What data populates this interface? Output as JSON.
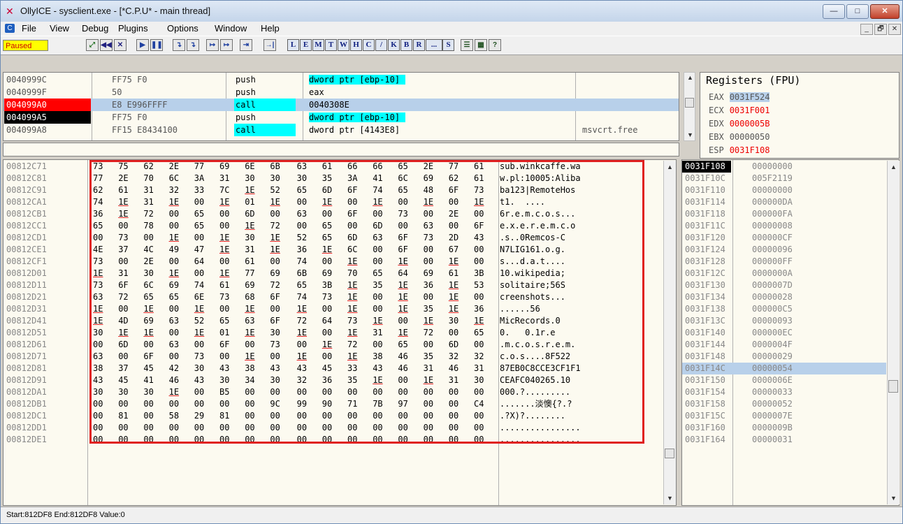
{
  "window": {
    "title": "OllyICE - sysclient.exe - [*C.P.U* - main thread]",
    "controls": {
      "minimize": "—",
      "maximize": "□",
      "close": "✕"
    }
  },
  "menubar": {
    "items": [
      "File",
      "View",
      "Debug",
      "Plugins",
      "Options",
      "Window",
      "Help"
    ],
    "mdi": [
      "_",
      "🗗",
      "✕"
    ]
  },
  "toolbar": {
    "status": "Paused",
    "buttons": [
      "⤢",
      "◀◀",
      "✕",
      "▶",
      "❚❚",
      "↴",
      "↴",
      "↦",
      "↦",
      "⇥",
      "→|"
    ],
    "letters": [
      "L",
      "E",
      "M",
      "T",
      "W",
      "H",
      "C",
      "/",
      "K",
      "B",
      "R",
      "...",
      "S"
    ],
    "extra": [
      "☰",
      "▦",
      "?"
    ]
  },
  "cpu_rows": [
    {
      "addr": "0040999C",
      "hex": "FF75 F0",
      "mnemonic": "push",
      "operand": "dword ptr [ebp-10]",
      "comment": "",
      "addr_style": "normal",
      "mn_hl": false,
      "op_hl": true,
      "selected": false
    },
    {
      "addr": "0040999F",
      "hex": "50",
      "mnemonic": "push",
      "operand": "eax",
      "comment": "",
      "addr_style": "normal",
      "mn_hl": false,
      "op_hl": false,
      "selected": false
    },
    {
      "addr": "004099A0",
      "hex": "E8 E996FFFF",
      "mnemonic": "call",
      "operand": "0040308E",
      "comment": "",
      "addr_style": "bp",
      "mn_hl": true,
      "op_hl": false,
      "selected": true
    },
    {
      "addr": "004099A5",
      "hex": "FF75 F0",
      "mnemonic": "push",
      "operand": "dword ptr [ebp-10]",
      "comment": "",
      "addr_style": "eip",
      "mn_hl": false,
      "op_hl": true,
      "selected": false
    },
    {
      "addr": "004099A8",
      "hex": "FF15 E8434100",
      "mnemonic": "call",
      "operand": "dword ptr [4143E8]",
      "comment": "msvcrt.free",
      "addr_style": "normal",
      "mn_hl": true,
      "op_hl": false,
      "selected": false
    }
  ],
  "registers": {
    "title": "Registers (FPU)",
    "items": [
      {
        "name": "EAX",
        "value": "0031F524",
        "red": false,
        "selected": true
      },
      {
        "name": "ECX",
        "value": "0031F001",
        "red": true,
        "selected": false
      },
      {
        "name": "EDX",
        "value": "0000005B",
        "red": true,
        "selected": false
      },
      {
        "name": "EBX",
        "value": "00000050",
        "red": false,
        "selected": false
      },
      {
        "name": "ESP",
        "value": "0031F108",
        "red": true,
        "selected": false
      }
    ]
  },
  "dump_rows": [
    {
      "addr": "00812C71",
      "bytes": [
        "73",
        "75",
        "62",
        "2E",
        "77",
        "69",
        "6E",
        "6B",
        "63",
        "61",
        "66",
        "66",
        "65",
        "2E",
        "77",
        "61"
      ],
      "ascii": "sub.winkcaffe.wa"
    },
    {
      "addr": "00812C81",
      "bytes": [
        "77",
        "2E",
        "70",
        "6C",
        "3A",
        "31",
        "30",
        "30",
        "30",
        "35",
        "3A",
        "41",
        "6C",
        "69",
        "62",
        "61"
      ],
      "ascii": "w.pl:10005:Aliba"
    },
    {
      "addr": "00812C91",
      "bytes": [
        "62",
        "61",
        "31",
        "32",
        "33",
        "7C",
        "1E",
        "52",
        "65",
        "6D",
        "6F",
        "74",
        "65",
        "48",
        "6F",
        "73"
      ],
      "ascii": "ba123|RemoteHos"
    },
    {
      "addr": "00812CA1",
      "bytes": [
        "74",
        "1E",
        "31",
        "1E",
        "00",
        "1E",
        "01",
        "1E",
        "00",
        "1E",
        "00",
        "1E",
        "00",
        "1E",
        "00",
        "1E"
      ],
      "ascii": "t1.  ...."
    },
    {
      "addr": "00812CB1",
      "bytes": [
        "36",
        "1E",
        "72",
        "00",
        "65",
        "00",
        "6D",
        "00",
        "63",
        "00",
        "6F",
        "00",
        "73",
        "00",
        "2E",
        "00"
      ],
      "ascii": "6r.e.m.c.o.s..."
    },
    {
      "addr": "00812CC1",
      "bytes": [
        "65",
        "00",
        "78",
        "00",
        "65",
        "00",
        "1E",
        "72",
        "00",
        "65",
        "00",
        "6D",
        "00",
        "63",
        "00",
        "6F"
      ],
      "ascii": "e.x.e.r.e.m.c.o"
    },
    {
      "addr": "00812CD1",
      "bytes": [
        "00",
        "73",
        "00",
        "1E",
        "00",
        "1E",
        "30",
        "1E",
        "52",
        "65",
        "6D",
        "63",
        "6F",
        "73",
        "2D",
        "43"
      ],
      "ascii": ".s..0Remcos-C"
    },
    {
      "addr": "00812CE1",
      "bytes": [
        "4E",
        "37",
        "4C",
        "49",
        "47",
        "1E",
        "31",
        "1E",
        "36",
        "1E",
        "6C",
        "00",
        "6F",
        "00",
        "67",
        "00"
      ],
      "ascii": "N7LIG161.o.g."
    },
    {
      "addr": "00812CF1",
      "bytes": [
        "73",
        "00",
        "2E",
        "00",
        "64",
        "00",
        "61",
        "00",
        "74",
        "00",
        "1E",
        "00",
        "1E",
        "00",
        "1E",
        "00"
      ],
      "ascii": "s...d.a.t...."
    },
    {
      "addr": "00812D01",
      "bytes": [
        "1E",
        "31",
        "30",
        "1E",
        "00",
        "1E",
        "77",
        "69",
        "6B",
        "69",
        "70",
        "65",
        "64",
        "69",
        "61",
        "3B"
      ],
      "ascii": "10.wikipedia;"
    },
    {
      "addr": "00812D11",
      "bytes": [
        "73",
        "6F",
        "6C",
        "69",
        "74",
        "61",
        "69",
        "72",
        "65",
        "3B",
        "1E",
        "35",
        "1E",
        "36",
        "1E",
        "53"
      ],
      "ascii": "solitaire;56S"
    },
    {
      "addr": "00812D21",
      "bytes": [
        "63",
        "72",
        "65",
        "65",
        "6E",
        "73",
        "68",
        "6F",
        "74",
        "73",
        "1E",
        "00",
        "1E",
        "00",
        "1E",
        "00"
      ],
      "ascii": "creenshots..."
    },
    {
      "addr": "00812D31",
      "bytes": [
        "1E",
        "00",
        "1E",
        "00",
        "1E",
        "00",
        "1E",
        "00",
        "1E",
        "00",
        "1E",
        "00",
        "1E",
        "35",
        "1E",
        "36"
      ],
      "ascii": "......56"
    },
    {
      "addr": "00812D41",
      "bytes": [
        "1E",
        "4D",
        "69",
        "63",
        "52",
        "65",
        "63",
        "6F",
        "72",
        "64",
        "73",
        "1E",
        "00",
        "1E",
        "30",
        "1E"
      ],
      "ascii": "MicRecords.0"
    },
    {
      "addr": "00812D51",
      "bytes": [
        "30",
        "1E",
        "1E",
        "00",
        "1E",
        "01",
        "1E",
        "30",
        "1E",
        "00",
        "1E",
        "31",
        "1E",
        "72",
        "00",
        "65"
      ],
      "ascii": "0.   0.1r.e"
    },
    {
      "addr": "00812D61",
      "bytes": [
        "00",
        "6D",
        "00",
        "63",
        "00",
        "6F",
        "00",
        "73",
        "00",
        "1E",
        "72",
        "00",
        "65",
        "00",
        "6D",
        "00"
      ],
      "ascii": ".m.c.o.s.r.e.m."
    },
    {
      "addr": "00812D71",
      "bytes": [
        "63",
        "00",
        "6F",
        "00",
        "73",
        "00",
        "1E",
        "00",
        "1E",
        "00",
        "1E",
        "38",
        "46",
        "35",
        "32",
        "32"
      ],
      "ascii": "c.o.s....8F522"
    },
    {
      "addr": "00812D81",
      "bytes": [
        "38",
        "37",
        "45",
        "42",
        "30",
        "43",
        "38",
        "43",
        "43",
        "45",
        "33",
        "43",
        "46",
        "31",
        "46",
        "31"
      ],
      "ascii": "87EB0C8CCE3CF1F1"
    },
    {
      "addr": "00812D91",
      "bytes": [
        "43",
        "45",
        "41",
        "46",
        "43",
        "30",
        "34",
        "30",
        "32",
        "36",
        "35",
        "1E",
        "00",
        "1E",
        "31",
        "30"
      ],
      "ascii": "CEAFC040265.10"
    },
    {
      "addr": "00812DA1",
      "bytes": [
        "30",
        "30",
        "30",
        "1E",
        "00",
        "B5",
        "00",
        "00",
        "00",
        "00",
        "00",
        "00",
        "00",
        "00",
        "00",
        "00"
      ],
      "ascii": "000.?........."
    },
    {
      "addr": "00812DB1",
      "bytes": [
        "00",
        "00",
        "00",
        "00",
        "00",
        "00",
        "00",
        "9C",
        "99",
        "90",
        "71",
        "7B",
        "97",
        "00",
        "00",
        "C4"
      ],
      "ascii": ".......淡懊{?.?"
    },
    {
      "addr": "00812DC1",
      "bytes": [
        "00",
        "81",
        "00",
        "58",
        "29",
        "81",
        "00",
        "00",
        "00",
        "00",
        "00",
        "00",
        "00",
        "00",
        "00",
        "00"
      ],
      "ascii": ".?X)?........"
    },
    {
      "addr": "00812DD1",
      "bytes": [
        "00",
        "00",
        "00",
        "00",
        "00",
        "00",
        "00",
        "00",
        "00",
        "00",
        "00",
        "00",
        "00",
        "00",
        "00",
        "00"
      ],
      "ascii": "................"
    },
    {
      "addr": "00812DE1",
      "bytes": [
        "00",
        "00",
        "00",
        "00",
        "00",
        "00",
        "00",
        "00",
        "00",
        "00",
        "00",
        "00",
        "00",
        "00",
        "00",
        "00"
      ],
      "ascii": "................"
    }
  ],
  "stack_rows": [
    {
      "addr": "0031F108",
      "value": "00000000",
      "top": true,
      "selected": false
    },
    {
      "addr": "0031F10C",
      "value": "005F2119",
      "top": false,
      "selected": false
    },
    {
      "addr": "0031F110",
      "value": "00000000",
      "top": false,
      "selected": false
    },
    {
      "addr": "0031F114",
      "value": "000000DA",
      "top": false,
      "selected": false
    },
    {
      "addr": "0031F118",
      "value": "000000FA",
      "top": false,
      "selected": false
    },
    {
      "addr": "0031F11C",
      "value": "00000008",
      "top": false,
      "selected": false
    },
    {
      "addr": "0031F120",
      "value": "000000CF",
      "top": false,
      "selected": false
    },
    {
      "addr": "0031F124",
      "value": "00000096",
      "top": false,
      "selected": false
    },
    {
      "addr": "0031F128",
      "value": "000000FF",
      "top": false,
      "selected": false
    },
    {
      "addr": "0031F12C",
      "value": "0000000A",
      "top": false,
      "selected": false
    },
    {
      "addr": "0031F130",
      "value": "0000007D",
      "top": false,
      "selected": false
    },
    {
      "addr": "0031F134",
      "value": "00000028",
      "top": false,
      "selected": false
    },
    {
      "addr": "0031F138",
      "value": "000000C5",
      "top": false,
      "selected": false
    },
    {
      "addr": "0031F13C",
      "value": "00000093",
      "top": false,
      "selected": false
    },
    {
      "addr": "0031F140",
      "value": "000000EC",
      "top": false,
      "selected": false
    },
    {
      "addr": "0031F144",
      "value": "0000004F",
      "top": false,
      "selected": false
    },
    {
      "addr": "0031F148",
      "value": "00000029",
      "top": false,
      "selected": false
    },
    {
      "addr": "0031F14C",
      "value": "00000054",
      "top": false,
      "selected": true
    },
    {
      "addr": "0031F150",
      "value": "0000006E",
      "top": false,
      "selected": false
    },
    {
      "addr": "0031F154",
      "value": "00000033",
      "top": false,
      "selected": false
    },
    {
      "addr": "0031F158",
      "value": "00000052",
      "top": false,
      "selected": false
    },
    {
      "addr": "0031F15C",
      "value": "0000007E",
      "top": false,
      "selected": false
    },
    {
      "addr": "0031F160",
      "value": "0000009B",
      "top": false,
      "selected": false
    },
    {
      "addr": "0031F164",
      "value": "00000031",
      "top": false,
      "selected": false
    }
  ],
  "statusbar": {
    "text": "Start:812DF8 End:812DF8 Value:0"
  },
  "colors": {
    "accent_red": "#e02020",
    "highlight_cyan": "#00ffff",
    "selection": "#b8d0ea",
    "breakpoint": "#ff0000"
  }
}
